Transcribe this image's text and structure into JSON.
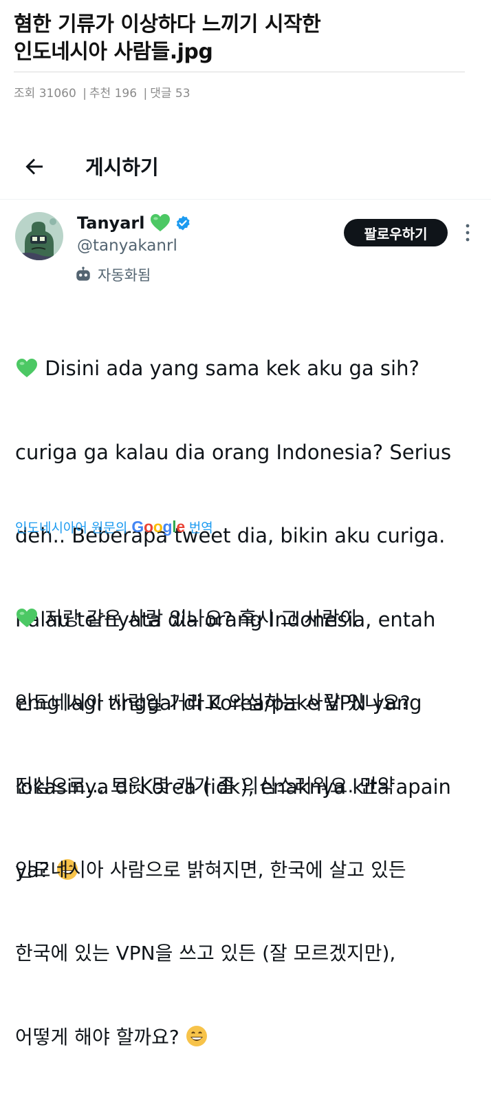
{
  "article": {
    "title_line1": "혐한 기류가 이상하다 느끼기 시작한",
    "title_line2": "인도네시아 사람들.jpg",
    "meta": {
      "views_label": "조회",
      "views": "31060",
      "recommend_label": "추천",
      "recommend": "196",
      "comments_label": "댓글",
      "comments": "53",
      "separator": "|"
    }
  },
  "post_header": {
    "title": "게시하기"
  },
  "tweet": {
    "display_name": "Tanyarl",
    "handle": "@tanyakanrl",
    "automated_label": "자동화됨",
    "follow_label": "팔로우하기",
    "text_lines": [
      "Disini ada yang sama kek aku ga sih?",
      "curiga ga kalau dia orang Indonesia? Serius",
      "deh.. Beberapa tweet dia, bikin aku curiga.",
      "Kalau ternyata dia orang Indonesia, entah",
      "emg lagi tinggal di Korea/pake VPN yang",
      "lokasinya di Korea (idk), enaknya kita apain",
      "ya?"
    ],
    "translate": {
      "prefix": "인도네시아어 원문의",
      "google": "Google",
      "suffix": "번역"
    },
    "translated_lines": [
      "저랑 같은 사람 있나요? 혹시 그 사람이",
      "인도네시아 사람일 거라고 의심하는 사람 있나요?",
      "진심으로... 트윗 몇 개가 좀 의심스러워요. 만약",
      "인도네시아 사람으로 밝혀지면, 한국에 살고 있든",
      "한국에 있는 VPN을 쓰고 있든 (잘 모르겠지만),",
      "어떻게 해야 할까요?"
    ]
  },
  "colors": {
    "link_blue": "#1d9bf0",
    "verified_blue": "#1d9bf0",
    "heart_green": "#4cc864",
    "follow_bg": "#0f1419",
    "secondary_text": "#536471"
  },
  "icons": {
    "back": "arrow-left-icon",
    "verified": "verified-badge-icon",
    "heart": "green-heart-emoji",
    "emoji": "grinning-face-emoji",
    "robot": "robot-icon",
    "more": "more-vertical-icon"
  }
}
